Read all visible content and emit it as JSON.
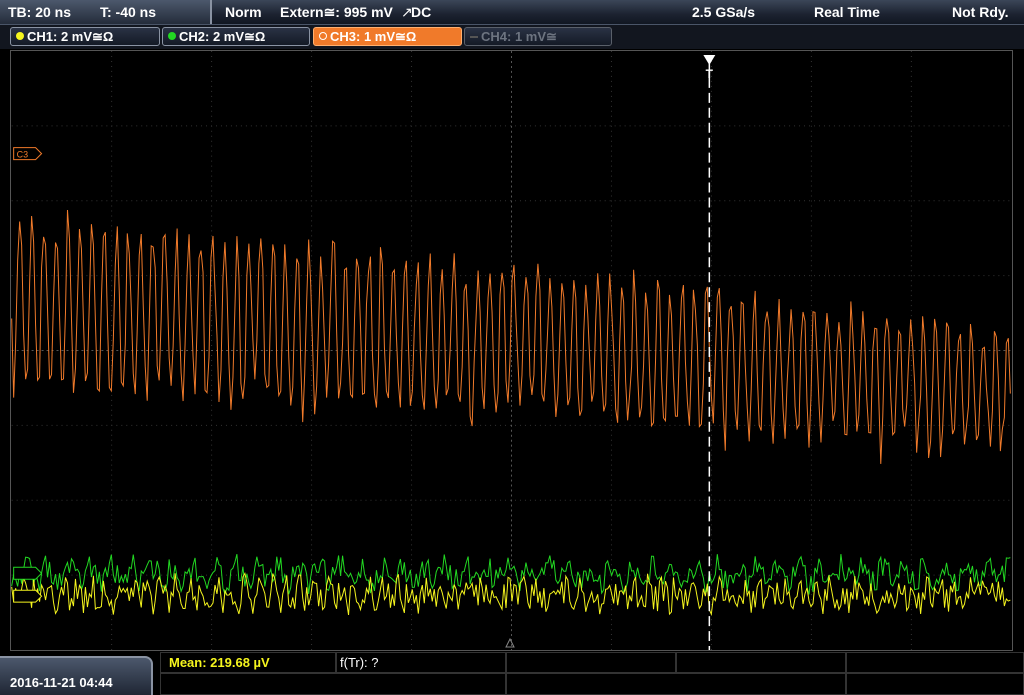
{
  "topbar": {
    "timebase": "TB: 20 ns",
    "trigger_time": "T: -40 ns",
    "trigger_mode": "Norm",
    "trigger_source": "Extern≅: 995 mV",
    "trigger_coupling": "DC",
    "sample_rate": "2.5 GSa/s",
    "acq_mode": "Real Time",
    "status": "Not Rdy."
  },
  "channels": [
    {
      "label": "CH1: 2 mV≅Ω",
      "color": "#f5f51e",
      "state": "on"
    },
    {
      "label": "CH2: 2 mV≅Ω",
      "color": "#22d822",
      "state": "on"
    },
    {
      "label": "CH3: 1 mV≅Ω",
      "color": "#f07a2a",
      "state": "active"
    },
    {
      "label": "CH4: 1 mV≅",
      "color": "#6d7480",
      "state": "off"
    }
  ],
  "markers": {
    "ch3_offset": "C3",
    "trigger_position": "T"
  },
  "footer": {
    "datetime": "2016-11-21 04:44",
    "measurement": "Mean: 219.68 µV",
    "freq": "f(Tr): ?"
  },
  "colors": {
    "ch1": "#f5f51e",
    "ch2": "#22d822",
    "ch3": "#f07a2a",
    "grid": "#3a3a3a"
  }
}
